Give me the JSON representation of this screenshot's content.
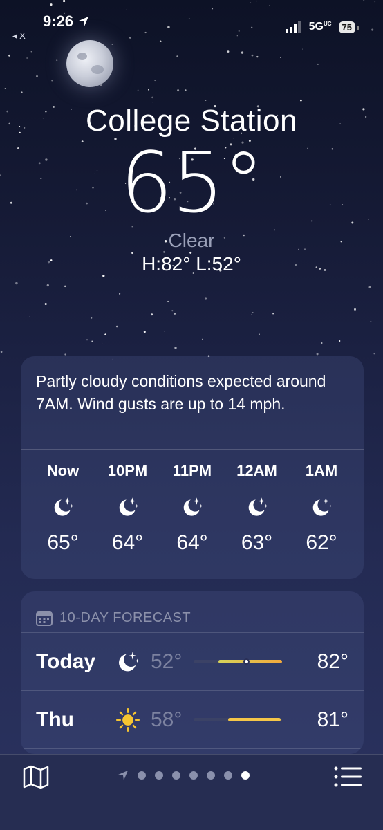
{
  "status_bar": {
    "time": "9:26",
    "back_app": "◂ X",
    "network": "5G",
    "network_suffix": "UC",
    "battery": "75"
  },
  "location": {
    "city": "College Station",
    "temperature": "65°",
    "condition": "Clear",
    "hi_lo": "H:82°  L:52°"
  },
  "hourly": {
    "summary": "Partly cloudy conditions expected around 7AM. Wind gusts are up to 14 mph.",
    "hours": [
      {
        "label": "Now",
        "icon": "moon-stars-icon",
        "temp": "65°"
      },
      {
        "label": "10PM",
        "icon": "moon-stars-icon",
        "temp": "64°"
      },
      {
        "label": "11PM",
        "icon": "moon-stars-icon",
        "temp": "64°"
      },
      {
        "label": "12AM",
        "icon": "moon-stars-icon",
        "temp": "63°"
      },
      {
        "label": "1AM",
        "icon": "moon-stars-icon",
        "temp": "62°"
      }
    ]
  },
  "forecast": {
    "title": "10-DAY FORECAST",
    "days": [
      {
        "day": "Today",
        "icon": "moon-stars-icon",
        "low": "52°",
        "high": "82°",
        "current_marker": true
      },
      {
        "day": "Thu",
        "icon": "sun-icon",
        "low": "58°",
        "high": "81°",
        "current_marker": false
      }
    ]
  },
  "bottom_bar": {
    "page_count": 7,
    "active_page": 6
  },
  "colors": {
    "sun": "#f6c531",
    "bar_today_start": "#d6d35a",
    "bar_today_end": "#f3a93c",
    "bar_thu": "#f5c648"
  }
}
